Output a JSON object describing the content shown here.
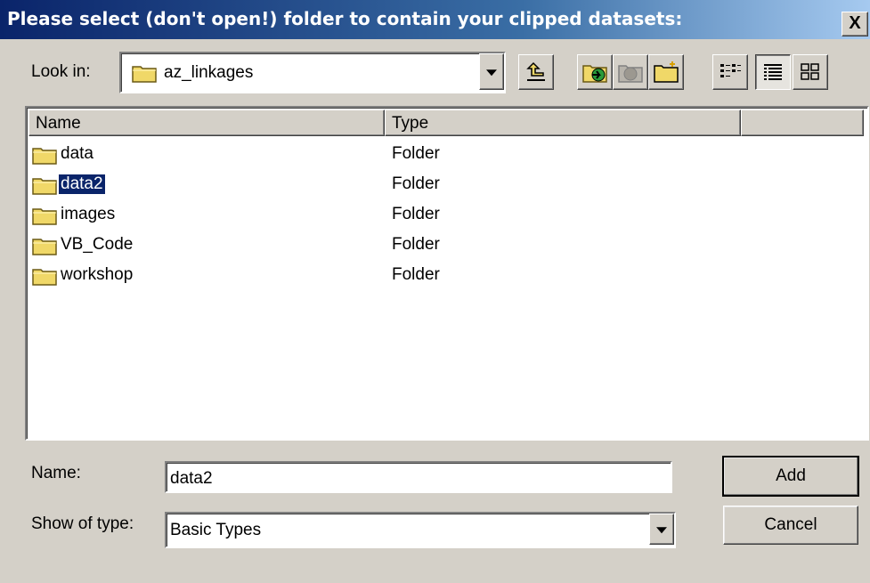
{
  "window": {
    "title": "Please select (don't open!) folder to contain your clipped datasets:",
    "close_glyph": "X"
  },
  "toolbar": {
    "lookin_label": "Look in:",
    "lookin_value": "az_linkages",
    "buttons": [
      "up-one-level-icon",
      "connect-to-folder-icon",
      "disconnect-folder-icon",
      "new-folder-icon",
      "list-view-icon",
      "details-view-icon",
      "thumbnails-view-icon"
    ]
  },
  "list": {
    "headers": [
      "Name",
      "Type",
      ""
    ],
    "rows": [
      {
        "name": "data",
        "type": "Folder"
      },
      {
        "name": "data2",
        "type": "Folder",
        "selected": true
      },
      {
        "name": "images",
        "type": "Folder"
      },
      {
        "name": "VB_Code",
        "type": "Folder"
      },
      {
        "name": "workshop",
        "type": "Folder"
      }
    ]
  },
  "form": {
    "name_label": "Name:",
    "name_value": "data2",
    "type_label": "Show of type:",
    "type_value": "Basic Types"
  },
  "buttons": {
    "add": "Add",
    "cancel": "Cancel"
  },
  "colors": {
    "title_gradient_start": "#0a246a",
    "title_gradient_end": "#a6caf0",
    "face": "#d4d0c8",
    "selection": "#0a246a",
    "folder_yellow": "#f0d868"
  }
}
